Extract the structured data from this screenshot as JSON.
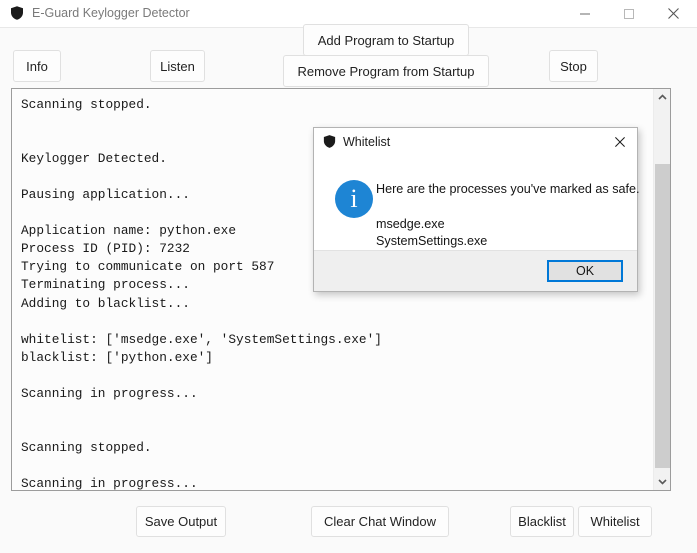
{
  "window": {
    "title": "E-Guard Keylogger Detector",
    "icon": "shield-icon",
    "controls": {
      "minimize": "minimize-icon",
      "maximize": "maximize-icon",
      "close": "close-icon"
    }
  },
  "toolbar": {
    "info_label": "Info",
    "listen_label": "Listen",
    "add_startup_label": "Add Program to Startup",
    "remove_startup_label": "Remove Program from Startup",
    "stop_label": "Stop"
  },
  "log": {
    "lines": [
      "Scanning stopped.",
      "",
      "",
      "Keylogger Detected.",
      "",
      "Pausing application...",
      "",
      "Application name: python.exe",
      "Process ID (PID): 7232",
      "Trying to communicate on port 587",
      "Terminating process...",
      "Adding to blacklist...",
      "",
      "whitelist: ['msedge.exe', 'SystemSettings.exe']",
      "blacklist: ['python.exe']",
      "",
      "Scanning in progress...",
      "",
      "",
      "Scanning stopped.",
      "",
      "Scanning in progress..."
    ],
    "text": "Scanning stopped.\n\n\nKeylogger Detected.\n\nPausing application...\n\nApplication name: python.exe\nProcess ID (PID): 7232\nTrying to communicate on port 587\nTerminating process...\nAdding to blacklist...\n\nwhitelist: ['msedge.exe', 'SystemSettings.exe']\nblacklist: ['python.exe']\n\nScanning in progress...\n\n\nScanning stopped.\n\nScanning in progress...",
    "scrollbar": {
      "up_arrow": "chevron-up-icon",
      "down_arrow": "chevron-down-icon"
    }
  },
  "footer": {
    "save_output_label": "Save Output",
    "clear_chat_label": "Clear Chat Window",
    "blacklist_label": "Blacklist",
    "whitelist_label": "Whitelist"
  },
  "dialog": {
    "title": "Whitelist",
    "icon": "shield-icon",
    "close": "close-icon",
    "info_icon_glyph": "i",
    "message": "Here are the processes you've marked as safe.",
    "items": [
      "msedge.exe",
      "SystemSettings.exe"
    ],
    "items_text": "msedge.exe\nSystemSettings.exe",
    "ok_label": "OK"
  },
  "colors": {
    "accent": "#0078d7",
    "info_icon": "#1e85d4",
    "window_bg": "#fafafa",
    "log_bg": "#fcfcfc",
    "scrollbar_thumb": "#cdcdcd"
  }
}
